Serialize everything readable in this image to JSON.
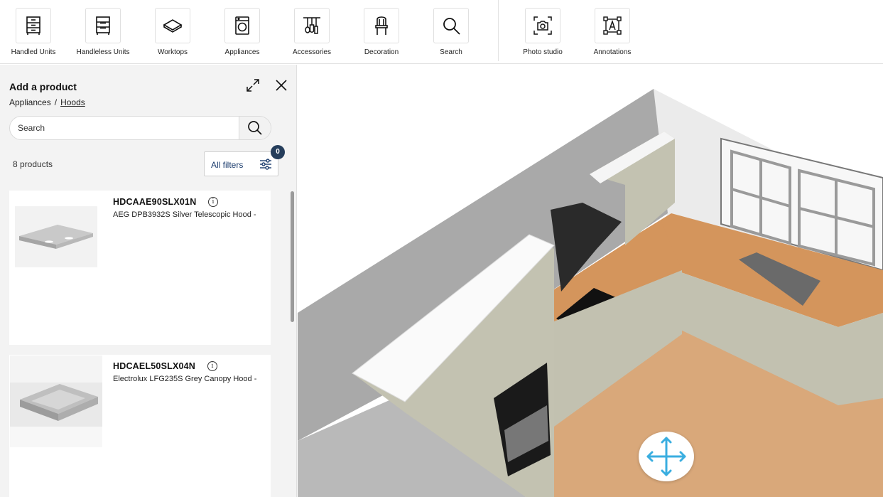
{
  "toolbar": {
    "items": [
      {
        "label": "Handled Units",
        "icon": "handled-units-icon"
      },
      {
        "label": "Handleless Units",
        "icon": "handleless-units-icon"
      },
      {
        "label": "Worktops",
        "icon": "worktop-icon"
      },
      {
        "label": "Appliances",
        "icon": "washing-machine-icon"
      },
      {
        "label": "Accessories",
        "icon": "utensils-icon"
      },
      {
        "label": "Decoration",
        "icon": "chair-icon"
      },
      {
        "label": "Search",
        "icon": "search-icon"
      },
      {
        "label": "Photo studio",
        "icon": "camera-icon"
      },
      {
        "label": "Annotations",
        "icon": "annotation-icon"
      }
    ]
  },
  "panel": {
    "title": "Add a product",
    "breadcrumb": {
      "parent": "Appliances",
      "separator": "/",
      "current": "Hoods"
    },
    "search": {
      "placeholder": "Search",
      "value": ""
    },
    "product_count": "8 products",
    "filters": {
      "label": "All filters",
      "badge": "0"
    },
    "products": [
      {
        "sku": "HDCAAE90SLX01N",
        "description": "AEG DPB3932S Silver Telescopic Hood -"
      },
      {
        "sku": "HDCAEL50SLX04N",
        "description": "Electrolux LFG235S Grey Canopy Hood -"
      }
    ]
  },
  "colors": {
    "accent_dark": "#253d5b",
    "link_blue": "#1c3d6e",
    "move_arrows": "#3aaee0",
    "worktop_wood": "#d9a06a",
    "cabinet_green": "#c3c2b1"
  }
}
